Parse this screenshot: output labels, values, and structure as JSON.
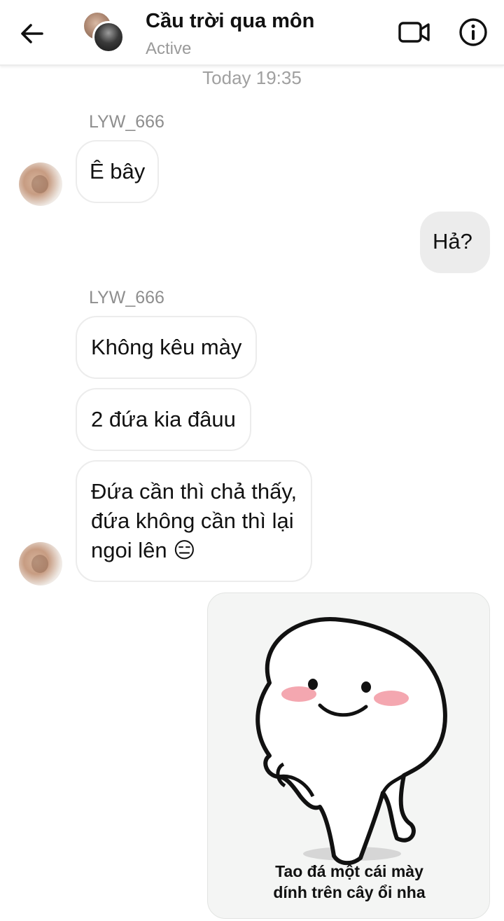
{
  "header": {
    "title": "Cầu trời qua môn",
    "status": "Active",
    "back_icon": "arrow-left-icon",
    "video_icon": "video-call-icon",
    "info_icon": "info-icon"
  },
  "conversation": {
    "timestamp": "Today 19:35",
    "groups": [
      {
        "sender": "LYW_666",
        "messages": [
          "Ê bây"
        ]
      },
      {
        "sender": "me",
        "messages": [
          "Hả?"
        ]
      },
      {
        "sender": "LYW_666",
        "messages": [
          "Không kêu mày",
          "2 đứa kia đâuu",
          "Đứa cần thì chả thấy,",
          "đứa không cần thì lại",
          "ngoi lên 😑"
        ]
      }
    ],
    "sticker": {
      "caption_line1": "Tao đá một cái mày",
      "caption_line2": "dính trên cây ổi nha"
    }
  },
  "colors": {
    "incoming_bubble_bg": "#ffffff",
    "incoming_bubble_border": "#ececec",
    "outgoing_bubble_bg": "#ececec",
    "secondary_text": "#9a9a9a",
    "cheek_pink": "#f4a7b0"
  }
}
